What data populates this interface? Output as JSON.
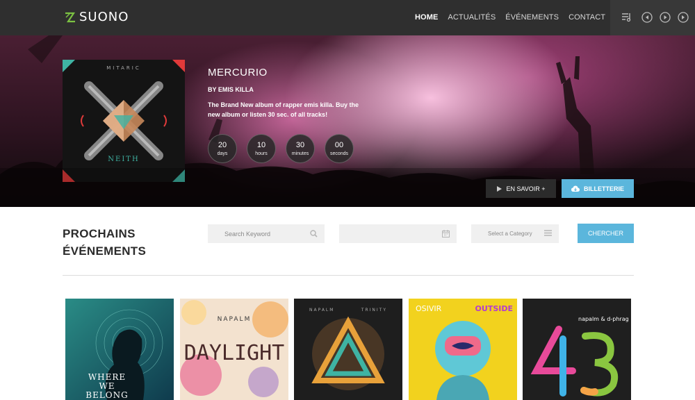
{
  "brand": {
    "name": "SUONO"
  },
  "nav": {
    "items": [
      {
        "label": "HOME",
        "active": true
      },
      {
        "label": "ACTUALITÉS",
        "active": false
      },
      {
        "label": "ÉVÉNEMENTS",
        "active": false
      },
      {
        "label": "CONTACT",
        "active": false
      }
    ]
  },
  "player": {
    "icons": [
      "playlist-icon",
      "previous-icon",
      "play-icon",
      "next-icon"
    ]
  },
  "hero": {
    "album_cover_text": {
      "top": "MITARIC",
      "bottom": "NEITH"
    },
    "title": "MERCURIO",
    "byline": "BY EMIS KILLA",
    "description": "The Brand New album of rapper emis killa. Buy the new album or listen 30 sec. of all tracks!",
    "countdown": [
      {
        "value": "20",
        "unit": "days"
      },
      {
        "value": "10",
        "unit": "hours"
      },
      {
        "value": "30",
        "unit": "minutes"
      },
      {
        "value": "00",
        "unit": "seconds"
      }
    ],
    "more_button": "EN SAVOIR +",
    "tickets_button": "BILLETTERIE"
  },
  "events": {
    "heading_line1": "PROCHAINS",
    "heading_line2": "ÉVÉNEMENTS",
    "search_placeholder": "Search Keyword",
    "date_value": "",
    "category_placeholder": "Select a Category",
    "search_button": "CHERCHER"
  },
  "cards": [
    {
      "title": "WHERE WE BELONG",
      "artist": ""
    },
    {
      "title": "DAYLIGHT",
      "artist": "NAPALM"
    },
    {
      "title": "TRINITY",
      "artist": "NAPALM"
    },
    {
      "title": "OUTSIDE",
      "artist": "OSIVIR"
    },
    {
      "title": "43",
      "artist": "napalm & d-phrag"
    }
  ],
  "colors": {
    "accent": "#5bb6dc",
    "nav_bg": "#2f2f2f",
    "logo_green": "#7cc242"
  }
}
